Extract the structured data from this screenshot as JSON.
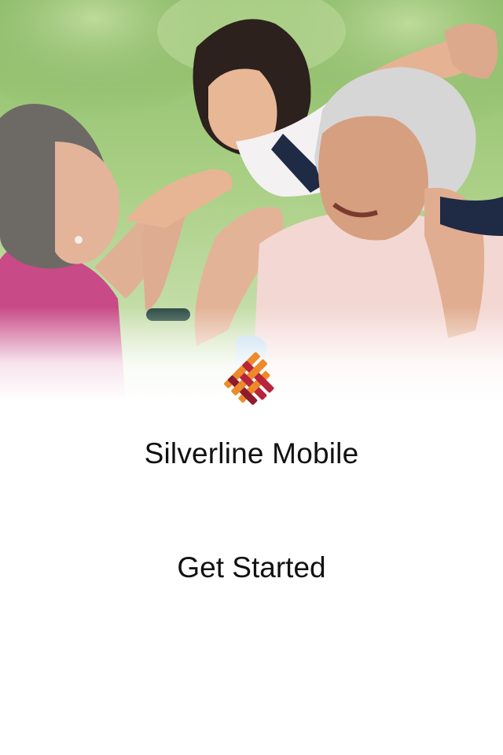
{
  "hero": {
    "image": "photo of grandparents playing with a young granddaughter in a park"
  },
  "brand": {
    "logo_icon": "woven-heart-icon",
    "colors": {
      "orange": "#EE8A2A",
      "red": "#B8243A",
      "dark_red": "#8E1B2E"
    }
  },
  "app_title": "Silverline Mobile",
  "actions": {
    "get_started_label": "Get Started"
  }
}
